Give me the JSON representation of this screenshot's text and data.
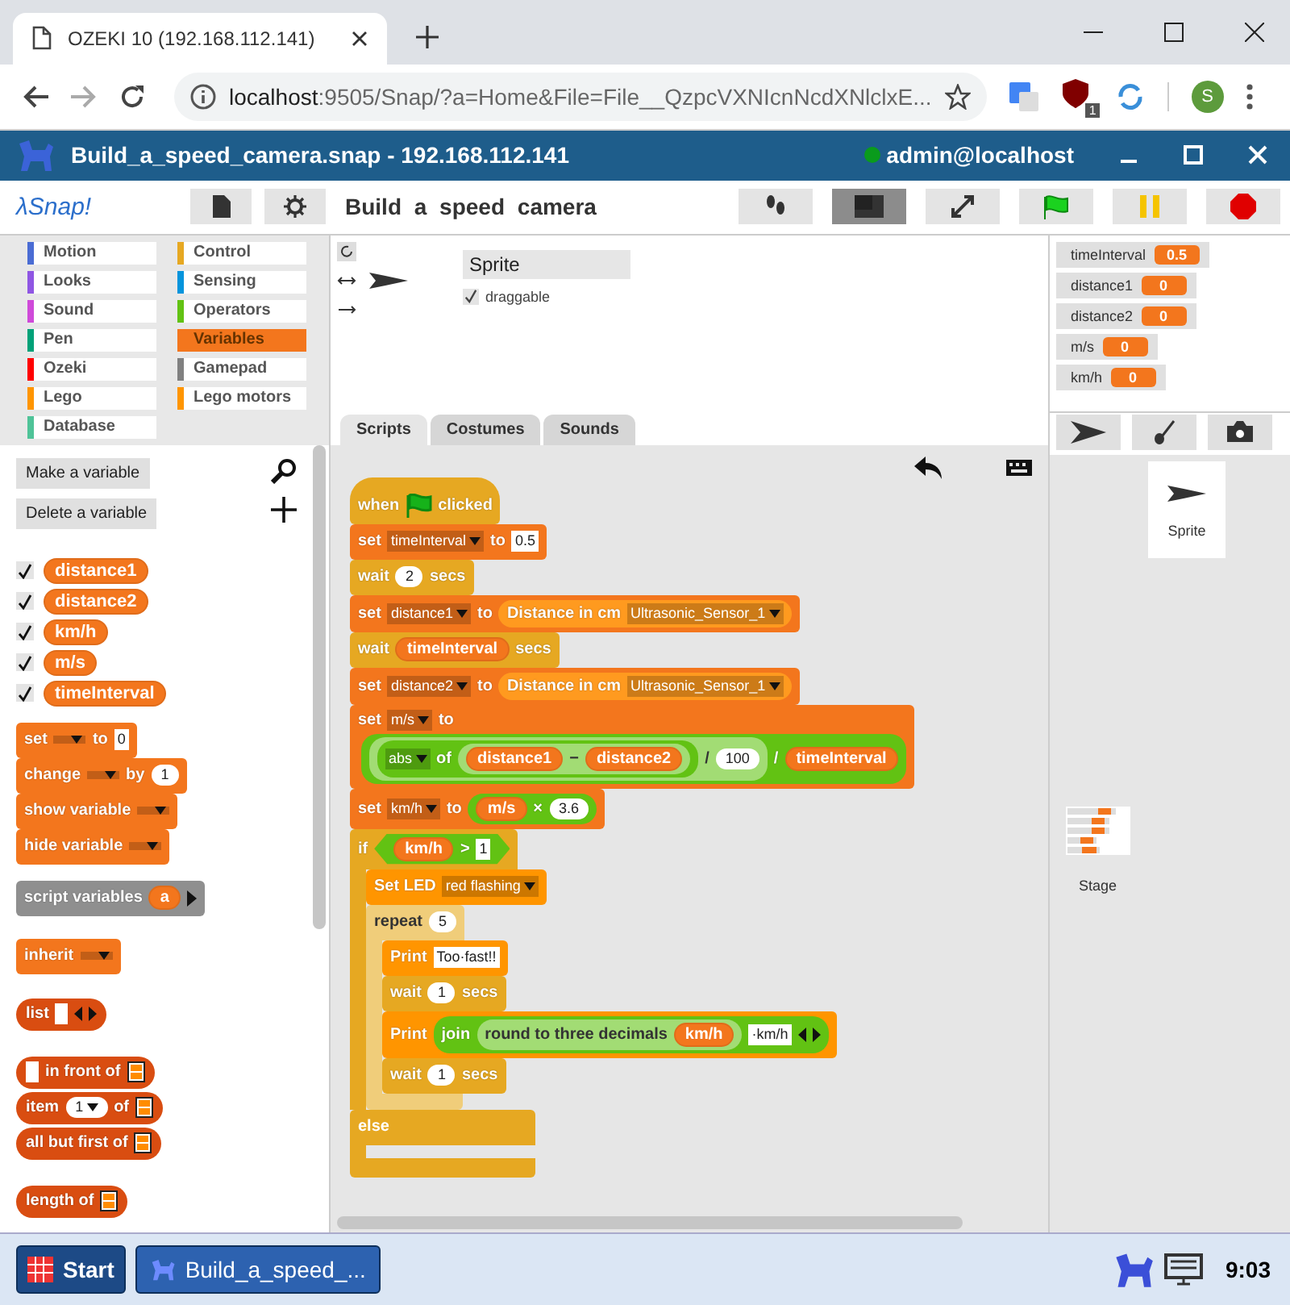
{
  "browser": {
    "tab_title": "OZEKI 10 (192.168.112.141)",
    "url_host": "localhost",
    "url_rest": ":9505/Snap/?a=Home&File=File__QzpcVXNIcnNcdXNlclxE...",
    "extension_badge": "1",
    "profile_initial": "S"
  },
  "app": {
    "title": "Build_a_speed_camera.snap - 192.168.112.141",
    "user": "admin@localhost",
    "online": true
  },
  "toolbar": {
    "logo": "λSnap!",
    "project_name": "Build a speed camera"
  },
  "categories": [
    {
      "label": "Motion",
      "color": "#4a6cd4",
      "selected": false
    },
    {
      "label": "Control",
      "color": "#e6a822",
      "selected": false
    },
    {
      "label": "Looks",
      "color": "#8f56e3",
      "selected": false
    },
    {
      "label": "Sensing",
      "color": "#0494dc",
      "selected": false
    },
    {
      "label": "Sound",
      "color": "#cf4ad9",
      "selected": false
    },
    {
      "label": "Operators",
      "color": "#62c213",
      "selected": false
    },
    {
      "label": "Pen",
      "color": "#00a178",
      "selected": false
    },
    {
      "label": "Variables",
      "color": "#f3761d",
      "selected": true
    },
    {
      "label": "Ozeki",
      "color": "#ff0000",
      "selected": false
    },
    {
      "label": "Gamepad",
      "color": "#808080",
      "selected": false
    },
    {
      "label": "Lego",
      "color": "#ff9500",
      "selected": false
    },
    {
      "label": "Lego motors",
      "color": "#ff9500",
      "selected": false
    },
    {
      "label": "Database",
      "color": "#4fc398",
      "selected": false
    }
  ],
  "palette": {
    "buttons": [
      "Make a variable",
      "Delete a variable"
    ],
    "variables": [
      {
        "name": "distance1",
        "checked": true
      },
      {
        "name": "distance2",
        "checked": true
      },
      {
        "name": "km/h",
        "checked": true
      },
      {
        "name": "m/s",
        "checked": true
      },
      {
        "name": "timeInterval",
        "checked": true
      }
    ],
    "groups": [
      [
        {
          "kind": "command",
          "color": "#f3761d",
          "parts": [
            {
              "kind": "label",
              "text": "set"
            },
            {
              "kind": "dropdown"
            },
            {
              "kind": "label",
              "text": "to"
            },
            {
              "kind": "text",
              "text": "0"
            }
          ]
        },
        {
          "kind": "command",
          "color": "#f3761d",
          "parts": [
            {
              "kind": "label",
              "text": "change"
            },
            {
              "kind": "dropdown"
            },
            {
              "kind": "label",
              "text": "by"
            },
            {
              "kind": "num",
              "text": "1"
            }
          ]
        },
        {
          "kind": "command",
          "color": "#f3761d",
          "parts": [
            {
              "kind": "label",
              "text": "show variable"
            },
            {
              "kind": "dropdown"
            }
          ]
        },
        {
          "kind": "command",
          "color": "#f3761d",
          "parts": [
            {
              "kind": "label",
              "text": "hide variable"
            },
            {
              "kind": "dropdown"
            }
          ]
        }
      ],
      [
        {
          "kind": "command",
          "color": "#8f8f8f",
          "parts": [
            {
              "kind": "label",
              "text": "script variables"
            },
            {
              "kind": "var",
              "text": "a"
            },
            {
              "kind": "arrow"
            }
          ]
        }
      ],
      [
        {
          "kind": "command",
          "color": "#f3761d",
          "parts": [
            {
              "kind": "label",
              "text": "inherit"
            },
            {
              "kind": "dropdown"
            }
          ]
        }
      ],
      [
        {
          "kind": "reporter",
          "color": "#d94d11",
          "parts": [
            {
              "kind": "label",
              "text": "list"
            },
            {
              "kind": "blank"
            },
            {
              "kind": "arrows"
            }
          ]
        }
      ],
      [
        {
          "kind": "reporter",
          "color": "#d94d11",
          "parts": [
            {
              "kind": "blank"
            },
            {
              "kind": "label",
              "text": "in front of"
            },
            {
              "kind": "listicon"
            }
          ]
        },
        {
          "kind": "reporter",
          "color": "#d94d11",
          "parts": [
            {
              "kind": "label",
              "text": "item"
            },
            {
              "kind": "num",
              "text": "1",
              "menu": true
            },
            {
              "kind": "label",
              "text": "of"
            },
            {
              "kind": "listicon"
            }
          ]
        },
        {
          "kind": "reporter",
          "color": "#d94d11",
          "parts": [
            {
              "kind": "label",
              "text": "all but first of"
            },
            {
              "kind": "listicon"
            }
          ]
        }
      ],
      [
        {
          "kind": "reporter",
          "color": "#d94d11",
          "parts": [
            {
              "kind": "label",
              "text": "length of"
            },
            {
              "kind": "listicon"
            }
          ]
        }
      ]
    ]
  },
  "sprite": {
    "name": "Sprite",
    "draggable_label": "draggable",
    "draggable": true
  },
  "tabs": [
    {
      "label": "Scripts",
      "selected": true
    },
    {
      "label": "Costumes",
      "selected": false
    },
    {
      "label": "Sounds",
      "selected": false
    }
  ],
  "script": [
    {
      "kind": "hat",
      "color": "#e6a822",
      "parts": [
        {
          "kind": "label",
          "text": "when"
        },
        {
          "kind": "flag"
        },
        {
          "kind": "label",
          "text": "clicked"
        }
      ]
    },
    {
      "kind": "command",
      "color": "#f3761d",
      "parts": [
        {
          "kind": "label",
          "text": "set"
        },
        {
          "kind": "dropdown",
          "text": "timeInterval"
        },
        {
          "kind": "label",
          "text": "to"
        },
        {
          "kind": "text",
          "text": "0.5"
        }
      ]
    },
    {
      "kind": "command",
      "color": "#e6a822",
      "parts": [
        {
          "kind": "label",
          "text": "wait"
        },
        {
          "kind": "num",
          "text": "2"
        },
        {
          "kind": "label",
          "text": "secs"
        }
      ]
    },
    {
      "kind": "command",
      "color": "#f3761d",
      "parts": [
        {
          "kind": "label",
          "text": "set"
        },
        {
          "kind": "dropdown",
          "text": "distance1"
        },
        {
          "kind": "label",
          "text": "to"
        },
        {
          "kind": "reporter",
          "color": "#ff9a1f",
          "parts": [
            {
              "kind": "label",
              "text": "Distance in cm"
            },
            {
              "kind": "dropdown",
              "text": "Ultrasonic_Sensor_1"
            }
          ]
        }
      ]
    },
    {
      "kind": "command",
      "color": "#e6a822",
      "parts": [
        {
          "kind": "label",
          "text": "wait"
        },
        {
          "kind": "var",
          "text": "timeInterval"
        },
        {
          "kind": "label",
          "text": "secs"
        }
      ]
    },
    {
      "kind": "command",
      "color": "#f3761d",
      "parts": [
        {
          "kind": "label",
          "text": "set"
        },
        {
          "kind": "dropdown",
          "text": "distance2"
        },
        {
          "kind": "label",
          "text": "to"
        },
        {
          "kind": "reporter",
          "color": "#ff9a1f",
          "parts": [
            {
              "kind": "label",
              "text": "Distance in cm"
            },
            {
              "kind": "dropdown",
              "text": "Ultrasonic_Sensor_1"
            }
          ]
        }
      ]
    },
    {
      "kind": "command",
      "color": "#f3761d",
      "wrap": true,
      "parts": [
        {
          "kind": "label",
          "text": "set"
        },
        {
          "kind": "dropdown",
          "text": "m/s"
        },
        {
          "kind": "label",
          "text": "to"
        },
        {
          "kind": "reporter",
          "color": "#62c213",
          "parts": [
            {
              "kind": "reporter",
              "color": "#a2dc74",
              "parts": [
                {
                  "kind": "reporter",
                  "color": "#62c213",
                  "parts": [
                    {
                      "kind": "dropdown",
                      "text": "abs"
                    },
                    {
                      "kind": "label",
                      "text": "of"
                    },
                    {
                      "kind": "reporter",
                      "color": "#a2dc74",
                      "parts": [
                        {
                          "kind": "var",
                          "text": "distance1"
                        },
                        {
                          "kind": "label",
                          "text": "−"
                        },
                        {
                          "kind": "var",
                          "text": "distance2"
                        }
                      ]
                    }
                  ]
                },
                {
                  "kind": "label",
                  "text": "/"
                },
                {
                  "kind": "num",
                  "text": "100"
                }
              ]
            },
            {
              "kind": "label",
              "text": "/"
            },
            {
              "kind": "var",
              "text": "timeInterval"
            }
          ]
        }
      ]
    },
    {
      "kind": "command",
      "color": "#f3761d",
      "parts": [
        {
          "kind": "label",
          "text": "set"
        },
        {
          "kind": "dropdown",
          "text": "km/h"
        },
        {
          "kind": "label",
          "text": "to"
        },
        {
          "kind": "reporter",
          "color": "#62c213",
          "parts": [
            {
              "kind": "var",
              "text": "m/s"
            },
            {
              "kind": "label",
              "text": "×"
            },
            {
              "kind": "num",
              "text": "3.6"
            }
          ]
        }
      ]
    },
    {
      "kind": "c",
      "color": "#e6a822",
      "parts": [
        {
          "kind": "label",
          "text": "if"
        },
        {
          "kind": "predicate",
          "color": "#62c213",
          "parts": [
            {
              "kind": "var",
              "text": "km/h"
            },
            {
              "kind": "label",
              "text": ">"
            },
            {
              "kind": "text",
              "text": "1"
            }
          ]
        }
      ],
      "body": [
        {
          "kind": "command",
          "color": "#ff9500",
          "parts": [
            {
              "kind": "label",
              "text": "Set LED"
            },
            {
              "kind": "dropdown",
              "text": "red flashing"
            }
          ]
        },
        {
          "kind": "c",
          "color": "#f0cd7a",
          "parts": [
            {
              "kind": "label",
              "text": "repeat"
            },
            {
              "kind": "num",
              "text": "5"
            }
          ],
          "body": [
            {
              "kind": "command",
              "color": "#ff9500",
              "parts": [
                {
                  "kind": "label",
                  "text": "Print"
                },
                {
                  "kind": "text",
                  "text": "Too·fast!!"
                }
              ]
            },
            {
              "kind": "command",
              "color": "#e6a822",
              "parts": [
                {
                  "kind": "label",
                  "text": "wait"
                },
                {
                  "kind": "num",
                  "text": "1"
                },
                {
                  "kind": "label",
                  "text": "secs"
                }
              ]
            },
            {
              "kind": "command",
              "color": "#ff9500",
              "parts": [
                {
                  "kind": "label",
                  "text": "Print"
                },
                {
                  "kind": "reporter",
                  "color": "#62c213",
                  "parts": [
                    {
                      "kind": "label",
                      "text": "join"
                    },
                    {
                      "kind": "reporter",
                      "color": "#a2dc74",
                      "parts": [
                        {
                          "kind": "label",
                          "text": "round to three decimals"
                        },
                        {
                          "kind": "var",
                          "text": "km/h"
                        }
                      ]
                    },
                    {
                      "kind": "text",
                      "text": "·km/h"
                    },
                    {
                      "kind": "arrows"
                    }
                  ]
                }
              ]
            },
            {
              "kind": "command",
              "color": "#e6a822",
              "parts": [
                {
                  "kind": "label",
                  "text": "wait"
                },
                {
                  "kind": "num",
                  "text": "1"
                },
                {
                  "kind": "label",
                  "text": "secs"
                }
              ]
            }
          ]
        }
      ],
      "else_label": "else"
    }
  ],
  "watchers": [
    {
      "label": "timeInterval",
      "value": "0.5"
    },
    {
      "label": "distance1",
      "value": "0"
    },
    {
      "label": "distance2",
      "value": "0"
    },
    {
      "label": "m/s",
      "value": "0"
    },
    {
      "label": "km/h",
      "value": "0"
    }
  ],
  "corral": {
    "sprites": [
      "Sprite"
    ],
    "stage": "Stage"
  },
  "taskbar": {
    "start": "Start",
    "window": "Build_a_speed_...",
    "clock": "9:03"
  }
}
